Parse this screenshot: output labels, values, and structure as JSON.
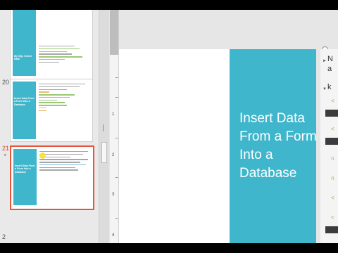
{
  "thumbnails": [
    {
      "number": "",
      "title": "My SQL Select Data",
      "selected": false
    },
    {
      "number": "20",
      "title": "Insert Data From a Form Into a Database",
      "selected": false
    },
    {
      "number": "21",
      "title": "Insert Data From a Form Into a Database",
      "selected": true
    }
  ],
  "slide": {
    "title": "Insert Data From a Form Into a Database"
  },
  "ruler": {
    "marks": [
      "1",
      "2",
      "3",
      "4"
    ]
  },
  "right_panel": {
    "texts": [
      "N",
      "a",
      "k"
    ]
  },
  "colors": {
    "accent": "#3fb6cc",
    "selection": "#e8533a"
  }
}
